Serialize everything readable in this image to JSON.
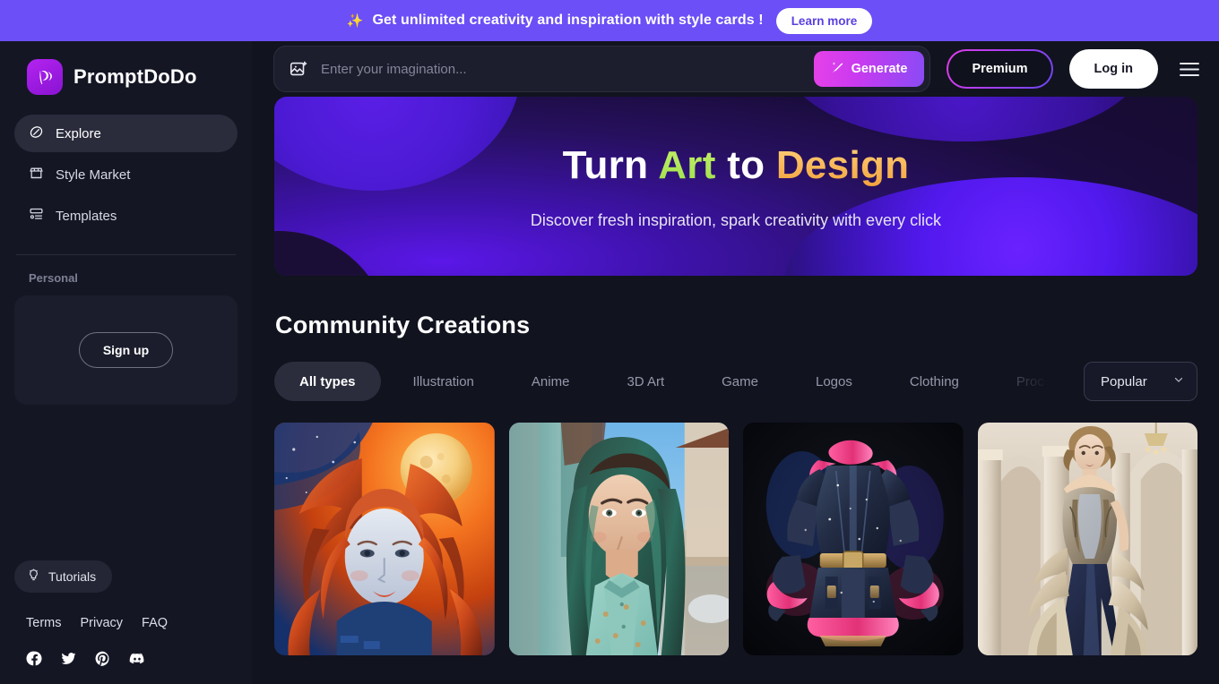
{
  "promo": {
    "icon": "sparkles-icon",
    "text": "Get unlimited creativity and inspiration with style cards !",
    "cta_label": "Learn more"
  },
  "sidebar": {
    "brand": {
      "name": "PromptDoDo",
      "logo_icon": "promptdodo-logo-icon"
    },
    "nav": [
      {
        "label": "Explore",
        "icon": "compass-icon",
        "active": true
      },
      {
        "label": "Style Market",
        "icon": "storefront-icon",
        "active": false
      },
      {
        "label": "Templates",
        "icon": "templates-icon",
        "active": false
      }
    ],
    "section_label": "Personal",
    "signup_label": "Sign up",
    "tutorials": {
      "label": "Tutorials",
      "icon": "lightbulb-icon"
    },
    "legal": [
      "Terms",
      "Privacy",
      "FAQ"
    ],
    "social": [
      {
        "name": "facebook-icon"
      },
      {
        "name": "twitter-icon"
      },
      {
        "name": "pinterest-icon"
      },
      {
        "name": "discord-icon"
      }
    ]
  },
  "topbar": {
    "upload_icon": "image-upload-icon",
    "search_placeholder": "Enter your imagination...",
    "search_value": "",
    "generate_label": "Generate",
    "generate_icon": "magic-wand-icon",
    "premium_label": "Premium",
    "login_label": "Log in",
    "menu_icon": "hamburger-menu-icon"
  },
  "hero": {
    "title_part1": "Turn ",
    "title_art": "Art",
    "title_part2": " to ",
    "title_design": "Design",
    "subtitle": "Discover fresh inspiration, spark creativity with every click"
  },
  "community": {
    "title": "Community Creations",
    "tabs": [
      {
        "label": "All types",
        "active": true
      },
      {
        "label": "Illustration",
        "active": false
      },
      {
        "label": "Anime",
        "active": false
      },
      {
        "label": "3D Art",
        "active": false
      },
      {
        "label": "Game",
        "active": false
      },
      {
        "label": "Logos",
        "active": false
      },
      {
        "label": "Clothing",
        "active": false
      },
      {
        "label": "Proc",
        "active": false
      }
    ],
    "sort": {
      "value": "Popular",
      "icon": "chevron-down-icon"
    },
    "cards": [
      {
        "name": "card-redhead-moon-illustration",
        "alt": "Illustration of a woman with flowing orange-red hair against a moon and swirling blue-orange sky"
      },
      {
        "name": "card-teal-hair-portrait",
        "alt": "Photoreal portrait of a woman with teal-green hair in a turquoise blouse on a sunny street"
      },
      {
        "name": "card-fantasy-armor-jacket",
        "alt": "Fantasy dark armor jacket with pink fur trim and glowing magic on black background"
      },
      {
        "name": "card-fashion-gown-model",
        "alt": "Fashion model in an ornate layered gown inside a classical marble hall"
      }
    ]
  },
  "colors": {
    "promo_bg": "#6c4ff6",
    "app_bg": "#11131f",
    "sidebar_bg": "#141624",
    "accent_magenta": "#e641e8",
    "accent_purple": "#8a4bf5",
    "brand_purple": "#b524f0",
    "hero_art": "#9ee04a",
    "hero_design": "#f2a23c"
  }
}
